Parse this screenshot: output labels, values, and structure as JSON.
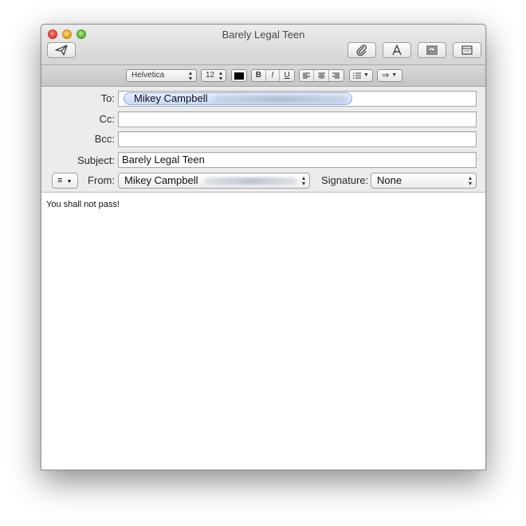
{
  "window": {
    "title": "Barely Legal Teen"
  },
  "toolbar": {
    "send_icon": "send-icon",
    "attach_icon": "paperclip-icon",
    "fonts_icon": "font-a-icon",
    "photo_icon": "photo-browser-icon",
    "template_icon": "stationery-icon"
  },
  "format": {
    "font": "Helvetica",
    "size": "12",
    "color": "#000000",
    "bold": "B",
    "italic": "I",
    "underline": "U"
  },
  "fields": {
    "to_label": "To:",
    "to_value": "Mikey Campbell",
    "cc_label": "Cc:",
    "cc_value": "",
    "bcc_label": "Bcc:",
    "bcc_value": "",
    "subject_label": "Subject:",
    "subject_value": "Barely Legal Teen",
    "from_label": "From:",
    "from_value": "Mikey Campbell",
    "signature_label": "Signature:",
    "signature_value": "None"
  },
  "message": {
    "body": "You shall not pass!"
  }
}
